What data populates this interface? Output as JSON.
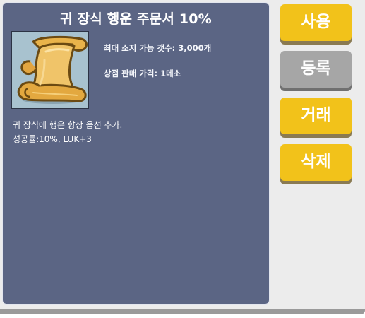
{
  "item": {
    "title": "귀 장식 행운 주문서 10%",
    "icon": "scroll-icon",
    "max_stack_label": "최대 소지 가능 갯수: 3,000개",
    "shop_price_label": "상점 판매 가격: 1메소",
    "description_line1": "귀 장식에 행운 향상 옵션 추가.",
    "description_line2": "성공률:10%, LUK+3"
  },
  "actions": {
    "use": "사용",
    "register": "등록",
    "trade": "거래",
    "delete": "삭제"
  },
  "colors": {
    "panel_bg": "#5b6584",
    "button_yellow": "#f2c21a",
    "button_gray": "#a6a6a6",
    "window_bg": "#ececec"
  }
}
